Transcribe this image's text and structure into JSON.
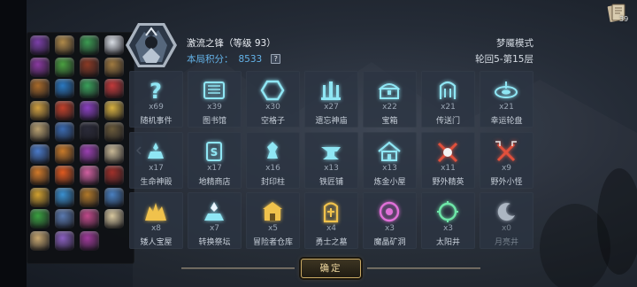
{
  "hero": {
    "name": "激流之锋（等级 93）",
    "score_label": "本局积分：",
    "score_value": "8533",
    "help_label": "?"
  },
  "mode": "梦魇模式",
  "round": "轮回5-第15层",
  "codex_count": "39",
  "confirm_label": "确定",
  "colors": {
    "accent_blue": "#64b4ea",
    "icon_cyan": "#8fe6f4",
    "gold": "#f0c24c",
    "pink": "#e070d8",
    "red": "#e0503c"
  },
  "relics": [
    "purple-wizard-hat",
    "scroll",
    "green-potion",
    "white-vase",
    "purple-gem-hat",
    "green-wand",
    "brown-bag",
    "slingshot",
    "treasure-chest",
    "blue-creature",
    "green-bowl",
    "red-potion",
    "gold-key",
    "red-orb",
    "purple-orb",
    "gold-potion",
    "old-scroll",
    "blue-mug",
    "top-hat",
    "dark-coin",
    "spell-book",
    "fox-mask",
    "purple-flask",
    "bone",
    "orange-ore",
    "fire-eye",
    "pink-candy",
    "red-tome",
    "gold-wreath",
    "blue-crystal",
    "bronze-bell",
    "blue-coins",
    "green-sprout",
    "magnifier",
    "potion-trio",
    "eggs",
    "horn",
    "rainbow-orb",
    "purple-sack",
    ""
  ],
  "events": [
    {
      "icon": "question-icon",
      "count": "x69",
      "name": "随机事件",
      "tone": "cyan"
    },
    {
      "icon": "library-icon",
      "count": "x39",
      "name": "图书馆",
      "tone": "cyan"
    },
    {
      "icon": "hexagon-icon",
      "count": "x30",
      "name": "空格子",
      "tone": "cyan"
    },
    {
      "icon": "shrine-icon",
      "count": "x27",
      "name": "遗忘神庙",
      "tone": "cyan"
    },
    {
      "icon": "treasure-chest-icon",
      "count": "x22",
      "name": "宝箱",
      "tone": "cyan"
    },
    {
      "icon": "portal-icon",
      "count": "x21",
      "name": "传送门",
      "tone": "cyan"
    },
    {
      "icon": "fortune-wheel-icon",
      "count": "x21",
      "name": "幸运轮盘",
      "tone": "cyan"
    },
    {
      "icon": "life-altar-icon",
      "count": "x17",
      "name": "生命神殿",
      "tone": "cyan"
    },
    {
      "icon": "gem-shop-icon",
      "count": "x17",
      "name": "地精商店",
      "tone": "cyan"
    },
    {
      "icon": "seal-pillar-icon",
      "count": "x16",
      "name": "封印柱",
      "tone": "cyan"
    },
    {
      "icon": "anvil-icon",
      "count": "x13",
      "name": "铁匠铺",
      "tone": "cyan"
    },
    {
      "icon": "alchemy-hut-icon",
      "count": "x13",
      "name": "炼金小屋",
      "tone": "cyan"
    },
    {
      "icon": "crossed-swords-elite-icon",
      "count": "x11",
      "name": "野外精英",
      "tone": "red"
    },
    {
      "icon": "crossed-swords-icon",
      "count": "x9",
      "name": "野外小怪",
      "tone": "red"
    },
    {
      "icon": "dwarf-treasure-icon",
      "count": "x8",
      "name": "矮人宝屋",
      "tone": "gold"
    },
    {
      "icon": "transfer-altar-icon",
      "count": "x7",
      "name": "转换祭坛",
      "tone": "cyan"
    },
    {
      "icon": "adventurer-warehouse-icon",
      "count": "x5",
      "name": "冒险者仓库",
      "tone": "gold"
    },
    {
      "icon": "warrior-tomb-icon",
      "count": "x4",
      "name": "勇士之墓",
      "tone": "gold"
    },
    {
      "icon": "demon-crystal-cave-icon",
      "count": "x3",
      "name": "魔晶矿洞",
      "tone": "pink"
    },
    {
      "icon": "sun-well-icon",
      "count": "x3",
      "name": "太阳井",
      "tone": "green"
    },
    {
      "icon": "moon-well-icon",
      "count": "x0",
      "name": "月亮井",
      "tone": "white",
      "dim": true
    }
  ]
}
